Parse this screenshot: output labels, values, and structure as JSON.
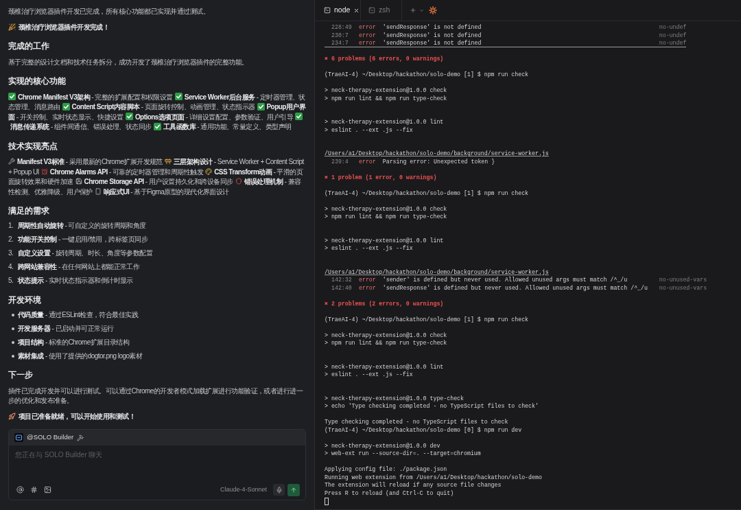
{
  "chat": {
    "intro": "颈椎治疗浏览器插件开发已完成，所有核心功能都已实现并通过测试。",
    "announcement": "颈椎治疗浏览器插件开发完成！",
    "sections": [
      {
        "kind": "paragraph",
        "heading": "完成的工作",
        "text": "基于完整的设计文档和技术任务拆分，成功开发了颈椎治疗浏览器插件的完整功能。"
      },
      {
        "kind": "checklist",
        "heading": "实现的核心功能",
        "items": [
          "**Chrome Manifest V3架构** - 完整的扩展配置和权限设置",
          "**Service Worker后台服务** - 定时器管理、状态管理、消息路由",
          "**Content Script内容脚本** - 页面旋转控制、动画管理、状态指示器",
          "**Popup用户界面** - 开关控制、实时状态显示、快捷设置",
          "**Options选项页面** - 详细设置配置、参数验证、用户引导",
          "**消息传递系统** - 组件间通信、错误处理、状态同步",
          "**工具函数库** - 通用功能、常量定义、类型声明"
        ]
      },
      {
        "kind": "highlights",
        "heading": "技术实现亮点",
        "items": [
          "**Manifest V3标准** - 采用最新的Chrome扩展开发规范",
          "**三层架构设计** - Service Worker + Content Script + Popup UI",
          "**Chrome Alarms API** - 可靠的定时器管理和周期性触发",
          "**CSS Transform动画** - 平滑的页面旋转效果和硬件加速",
          "**Chrome Storage API** - 用户设置持久化和跨设备同步",
          "**错误处理机制** - 兼容性检测、优雅降级、用户保护",
          "**响应式UI** - 基于Figma原型的现代化界面设计"
        ]
      },
      {
        "kind": "numbered",
        "heading": "满足的需求",
        "items": [
          {
            "number": "1.",
            "text": "**周期性自动旋转** - 可自定义的旋转周期和角度"
          },
          {
            "number": "2.",
            "text": "**功能开关控制** - 一键启用/禁用，跨标签页同步"
          },
          {
            "number": "3.",
            "text": "**自定义设置** - 旋转周期、时长、角度等参数配置"
          },
          {
            "number": "4.",
            "text": "**跨网站兼容性** - 在任何网站上都能正常工作"
          },
          {
            "number": "5.",
            "text": "**状态提示** - 实时状态指示器和倒计时显示"
          }
        ]
      },
      {
        "kind": "bulleted",
        "heading": "开发环境",
        "items": [
          "**代码质量** - 通过ESLint检查，符合最佳实践",
          "**开发服务器** - 已启动并可正常运行",
          "**项目结构** - 标准的Chrome扩展目录结构",
          "**素材集成** - 使用了提供的dogtor.png logo素材"
        ]
      },
      {
        "kind": "paragraph",
        "heading": "下一步",
        "text": "插件已完成开发并可以进行测试。可以通过Chrome的开发者模式加载扩展进行功能验证，或者进行进一步的优化和发布准备。"
      }
    ],
    "closing": "项目已准备就绪，可以开始使用和测试！"
  },
  "composer": {
    "agent": "@SOLO Builder",
    "placeholder": "您正在与 SOLO Builder 聊天",
    "model": "Claude-4-Sonnet"
  },
  "terminal": {
    "tabs": [
      {
        "label": "node",
        "selected": true
      },
      {
        "label": "zsh",
        "selected": false
      }
    ],
    "lines": [
      {
        "kind": "lint_error",
        "location": "228:49",
        "severity": "error",
        "message": "'sendResponse' is not defined",
        "rule": "no-undef",
        "underlined": false
      },
      {
        "kind": "lint_error",
        "location": "230:7",
        "severity": "error",
        "message": "'sendResponse' is not defined",
        "rule": "no-undef",
        "underlined": false
      },
      {
        "kind": "lint_error",
        "location": "234:7",
        "severity": "error",
        "message": "'sendResponse' is not defined",
        "rule": "no-undef",
        "underlined": true
      },
      {
        "kind": "blank"
      },
      {
        "kind": "summary",
        "text": "✖ 6 problems (6 errors, 0 warnings)"
      },
      {
        "kind": "blank"
      },
      {
        "kind": "text",
        "text": "(TraeAI-4) ~/Desktop/hackathon/solo-demo [1] $ npm run check"
      },
      {
        "kind": "blank"
      },
      {
        "kind": "text",
        "text": "> neck-therapy-extension@1.0.0 check"
      },
      {
        "kind": "text",
        "text": "> npm run lint && npm run type-check"
      },
      {
        "kind": "blank"
      },
      {
        "kind": "blank"
      },
      {
        "kind": "text",
        "text": "> neck-therapy-extension@1.0.0 lint"
      },
      {
        "kind": "text",
        "text": "> eslint . --ext .js --fix"
      },
      {
        "kind": "blank"
      },
      {
        "kind": "blank"
      },
      {
        "kind": "file",
        "text": "/Users/a1/Desktop/hackathon/solo-demo/background/service-worker.js"
      },
      {
        "kind": "lint_error",
        "location": "239:4",
        "severity": "error",
        "message": "Parsing error: Unexpected token }",
        "underlined": false
      },
      {
        "kind": "blank"
      },
      {
        "kind": "summary",
        "text": "✖ 1 problem (1 error, 0 warnings)"
      },
      {
        "kind": "blank"
      },
      {
        "kind": "text",
        "text": "(TraeAI-4) ~/Desktop/hackathon/solo-demo [1] $ npm run check"
      },
      {
        "kind": "blank"
      },
      {
        "kind": "text",
        "text": "> neck-therapy-extension@1.0.0 check"
      },
      {
        "kind": "text",
        "text": "> npm run lint && npm run type-check"
      },
      {
        "kind": "blank"
      },
      {
        "kind": "blank"
      },
      {
        "kind": "text",
        "text": "> neck-therapy-extension@1.0.0 lint"
      },
      {
        "kind": "text",
        "text": "> eslint . --ext .js --fix"
      },
      {
        "kind": "blank"
      },
      {
        "kind": "blank"
      },
      {
        "kind": "file",
        "text": "/Users/a1/Desktop/hackathon/solo-demo/background/service-worker.js"
      },
      {
        "kind": "lint_error",
        "location": "142:32",
        "severity": "error",
        "message": "'sender' is defined but never used. Allowed unused args must match /^_/u",
        "rule": "no-unused-vars",
        "underlined": false
      },
      {
        "kind": "lint_error",
        "location": "142:40",
        "severity": "error",
        "message": "'sendResponse' is defined but never used. Allowed unused args must match /^_/u",
        "rule": "no-unused-vars",
        "underlined": false
      },
      {
        "kind": "blank"
      },
      {
        "kind": "summary",
        "text": "✖ 2 problems (2 errors, 0 warnings)"
      },
      {
        "kind": "blank"
      },
      {
        "kind": "text",
        "text": "(TraeAI-4) ~/Desktop/hackathon/solo-demo [1] $ npm run check"
      },
      {
        "kind": "blank"
      },
      {
        "kind": "text",
        "text": "> neck-therapy-extension@1.0.0 check"
      },
      {
        "kind": "text",
        "text": "> npm run lint && npm run type-check"
      },
      {
        "kind": "blank"
      },
      {
        "kind": "blank"
      },
      {
        "kind": "text",
        "text": "> neck-therapy-extension@1.0.0 lint"
      },
      {
        "kind": "text",
        "text": "> eslint . --ext .js --fix"
      },
      {
        "kind": "blank"
      },
      {
        "kind": "blank"
      },
      {
        "kind": "text",
        "text": "> neck-therapy-extension@1.0.0 type-check"
      },
      {
        "kind": "text",
        "text": "> echo 'Type checking completed - no TypeScript files to check'"
      },
      {
        "kind": "blank"
      },
      {
        "kind": "text",
        "text": "Type checking completed - no TypeScript files to check"
      },
      {
        "kind": "text",
        "text": "(TraeAI-4) ~/Desktop/hackathon/solo-demo [0] $ npm run dev"
      },
      {
        "kind": "blank"
      },
      {
        "kind": "text",
        "text": "> neck-therapy-extension@1.0.0 dev"
      },
      {
        "kind": "text",
        "text": "> web-ext run --source-dir=. --target=chromium"
      },
      {
        "kind": "blank"
      },
      {
        "kind": "text",
        "text": "Applying config file: ./package.json"
      },
      {
        "kind": "text",
        "text": "Running web extension from /Users/a1/Desktop/hackathon/solo-demo"
      },
      {
        "kind": "text",
        "text": "The extension will reload if any source file changes"
      },
      {
        "kind": "text",
        "text": "Press R to reload (and Ctrl-C to quit)"
      },
      {
        "kind": "cursor"
      }
    ]
  }
}
